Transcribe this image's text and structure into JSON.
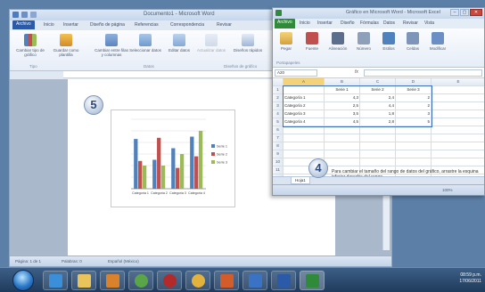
{
  "word": {
    "title": "Documento1 - Microsoft Word",
    "tabs": [
      "Archivo",
      "Inicio",
      "Insertar",
      "Diseño de página",
      "Referencias",
      "Correspondencia",
      "Revisar"
    ],
    "ribbon_buttons": [
      "Cambiar tipo de gráfico",
      "Guardar como plantilla",
      "Cambiar entre filas y columnas",
      "Seleccionar datos",
      "Editar datos",
      "Actualizar datos",
      "Diseños rápidos"
    ],
    "group_labels": [
      "Tipo",
      "Datos",
      "Diseños de gráfico"
    ],
    "status_page": "Página: 1 de 1",
    "status_words": "Palabras: 0",
    "status_lang": "Español (México)"
  },
  "callouts": {
    "word_callout": "5",
    "excel_callout": "4"
  },
  "excel": {
    "title": "Gráfico en Microsoft Word - Microsoft Excel",
    "file_tab": "Archivo",
    "tabs": [
      "Inicio",
      "Insertar",
      "Diseño",
      "Fórmulas",
      "Datos",
      "Revisar",
      "Vista"
    ],
    "ribbon_buttons": [
      "Pegar",
      "Fuente",
      "Alineación",
      "Número",
      "Estilos",
      "Celdas",
      "Modificar"
    ],
    "ribbon_groups": [
      "Portapapeles"
    ],
    "name_box": "A20",
    "fx": "fx",
    "columns": [
      "A",
      "B",
      "C",
      "D",
      "E"
    ],
    "header_row": [
      "",
      "Serie 1",
      "Serie 2",
      "Serie 3",
      ""
    ],
    "rows": [
      [
        "Categoría 1",
        "4,3",
        "2,4",
        "2",
        ""
      ],
      [
        "Categoría 2",
        "2,5",
        "4,4",
        "2",
        ""
      ],
      [
        "Categoría 3",
        "3,5",
        "1,8",
        "3",
        ""
      ],
      [
        "Categoría 4",
        "4,5",
        "2,8",
        "5",
        ""
      ]
    ],
    "row_numbers": [
      "1",
      "2",
      "3",
      "4",
      "5",
      "6",
      "7",
      "8",
      "9",
      "10",
      "11",
      "12"
    ],
    "hint_text": "Para cambiar el tamaño del rango de datos del gráfico, arrastre la esquina inferior derecha del rango.",
    "sheet_tab": "Hoja1",
    "zoom": "100%"
  },
  "chart_data": {
    "type": "bar",
    "categories": [
      "Categoría 1",
      "Categoría 2",
      "Categoría 3",
      "Categoría 4"
    ],
    "series": [
      {
        "name": "Serie 1",
        "values": [
          4.3,
          2.5,
          3.5,
          4.5
        ],
        "color": "#4f81bd"
      },
      {
        "name": "Serie 2",
        "values": [
          2.4,
          4.4,
          1.8,
          2.8
        ],
        "color": "#c0504d"
      },
      {
        "name": "Serie 3",
        "values": [
          2,
          2,
          3,
          5
        ],
        "color": "#9bbb59"
      }
    ],
    "ylim": [
      0,
      6
    ],
    "grid": true,
    "legend": "right"
  },
  "taskbar": {
    "apps": [
      "internet-explorer",
      "folder",
      "media",
      "chrome",
      "app-red",
      "chrome-2",
      "powerpoint",
      "outlook",
      "word",
      "excel"
    ],
    "time": "08:59 p.m.",
    "date": "17/06/2011"
  }
}
